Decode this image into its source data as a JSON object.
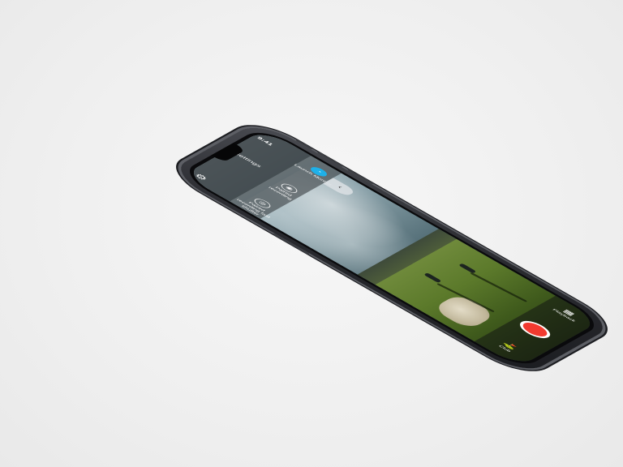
{
  "status_bar": {
    "time": "9:41"
  },
  "settings": {
    "title": "Settings"
  },
  "modes": [
    {
      "label": "Launch Monitor",
      "icon": "launch-monitor-icon",
      "active": true
    },
    {
      "label": "Paired recording",
      "icon": "camera-icon",
      "active": false
    },
    {
      "label": "Paired recording fast shutter",
      "icon": "camera-fast-icon",
      "active": false
    }
  ],
  "controls": {
    "playback_label": "Playback",
    "club_label": "Club"
  },
  "colors": {
    "accent": "#1fb0e8",
    "record": "#f23a2f"
  }
}
